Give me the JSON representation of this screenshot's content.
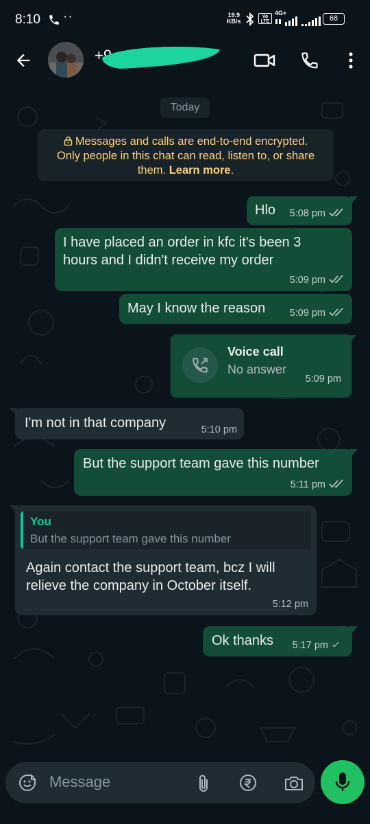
{
  "status_bar": {
    "time": "8:10",
    "dots": "··",
    "speed_value": "19.9",
    "speed_unit": "KB/s",
    "volte": "Vo LTE",
    "network": "4G+",
    "battery": "68"
  },
  "header": {
    "contact_name": "+9"
  },
  "chat": {
    "date_chip": "Today",
    "encryption_notice": {
      "line1": "Messages and calls are end-to-end encrypted.",
      "line2": "Only people in this chat can read, listen to, or share",
      "line3_prefix": "them. ",
      "link": "Learn more",
      "line3_suffix": "."
    },
    "messages": [
      {
        "direction": "out",
        "text": "Hlo",
        "time": "5:08 pm",
        "status": "read"
      },
      {
        "direction": "out",
        "text_line1": "I have placed an order in kfc it's been 3",
        "text_line2": "hours and I didn't receive my order",
        "time": "5:09 pm",
        "status": "read"
      },
      {
        "direction": "out",
        "text": "May I know the reason",
        "time": "5:09 pm",
        "status": "read"
      },
      {
        "direction": "out",
        "type": "call",
        "title": "Voice call",
        "subtitle": "No answer",
        "time": "5:09 pm"
      },
      {
        "direction": "in",
        "text": "I'm not in that company",
        "time": "5:10 pm"
      },
      {
        "direction": "out",
        "text": "But the support team gave this number",
        "time": "5:11 pm",
        "status": "read"
      },
      {
        "direction": "in",
        "reply_to_author": "You",
        "reply_to_text": "But the support team gave this number",
        "text_line1": "Again contact the support team, bcz I will",
        "text_line2": "relieve the company in October itself.",
        "time": "5:12 pm"
      },
      {
        "direction": "out",
        "text": "Ok thanks",
        "time": "5:17 pm",
        "status": "sent"
      }
    ]
  },
  "composer": {
    "placeholder": "Message"
  },
  "colors": {
    "background": "#0b141a",
    "outgoing_bubble": "#144d37",
    "incoming_bubble": "#202c33",
    "accent": "#21c063",
    "notice_text": "#ffd279",
    "read_tick": "#c5d1cc"
  },
  "icons": [
    "back-arrow-icon",
    "video-call-icon",
    "phone-icon",
    "more-vert-icon",
    "lock-icon",
    "double-tick-icon",
    "single-tick-icon",
    "missed-call-icon",
    "emoji-icon",
    "attach-icon",
    "rupee-icon",
    "camera-icon",
    "mic-icon"
  ]
}
